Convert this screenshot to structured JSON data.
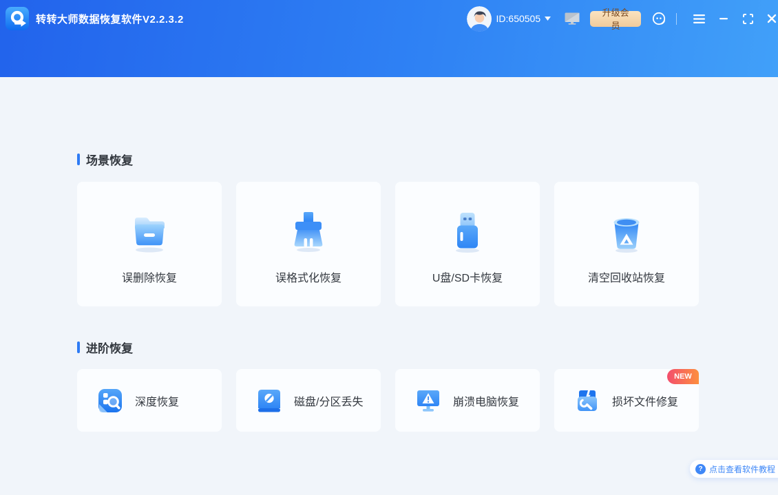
{
  "app": {
    "title": "转转大师数据恢复软件V2.2.3.2"
  },
  "header": {
    "user_id": "ID:650505",
    "upgrade_label": "升级会员"
  },
  "sections": {
    "scene": {
      "title": "场景恢复",
      "cards": [
        {
          "label": "误删除恢复",
          "icon": "folder-icon"
        },
        {
          "label": "误格式化恢复",
          "icon": "brush-icon"
        },
        {
          "label": "U盘/SD卡恢复",
          "icon": "usb-drive-icon"
        },
        {
          "label": "清空回收站恢复",
          "icon": "recycle-bin-icon"
        }
      ]
    },
    "advanced": {
      "title": "进阶恢复",
      "cards": [
        {
          "label": "深度恢复",
          "icon": "deep-scan-icon"
        },
        {
          "label": "磁盘/分区丢失",
          "icon": "disk-lost-icon"
        },
        {
          "label": "崩溃电脑恢复",
          "icon": "crashed-pc-icon"
        },
        {
          "label": "损坏文件修复",
          "icon": "file-repair-icon",
          "badge": "NEW"
        }
      ]
    }
  },
  "footer": {
    "help_text": "点击查看软件教程"
  },
  "colors": {
    "header_gradient_start": "#2263ec",
    "header_gradient_end": "#41a0f9",
    "content_bg": "#f1f5fa",
    "card_bg": "#fbfdff",
    "accent_blue": "#2e7bf4",
    "upgrade_bg": "#f6d8ae",
    "upgrade_text": "#7a4a21",
    "new_badge_start": "#f34e6d",
    "new_badge_end": "#fd8f3e"
  }
}
